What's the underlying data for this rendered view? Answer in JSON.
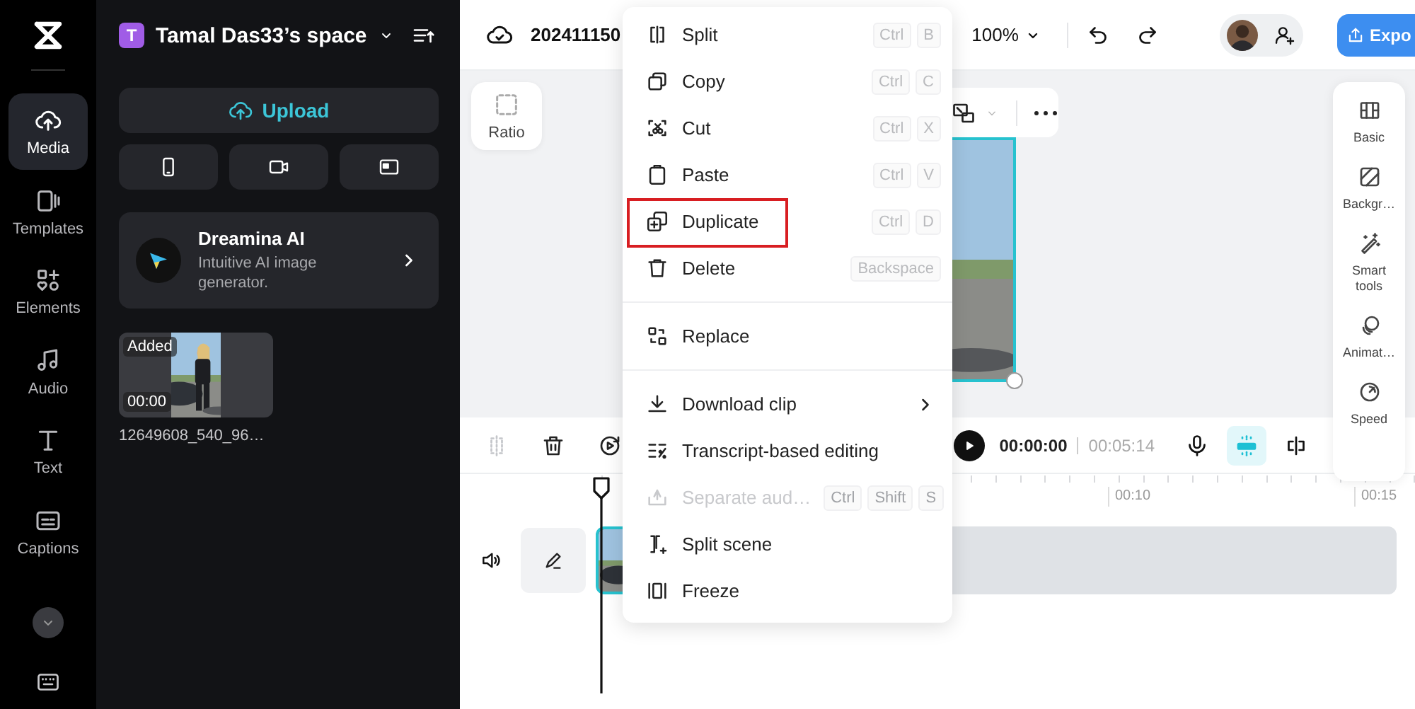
{
  "nav": {
    "items": [
      {
        "label": "Media",
        "selected": true
      },
      {
        "label": "Templates",
        "selected": false
      },
      {
        "label": "Elements",
        "selected": false
      },
      {
        "label": "Audio",
        "selected": false
      },
      {
        "label": "Text",
        "selected": false
      },
      {
        "label": "Captions",
        "selected": false
      }
    ]
  },
  "panel": {
    "space": {
      "initial": "T",
      "name": "Tamal Das33’s space"
    },
    "upload": "Upload",
    "promo": {
      "title": "Dreamina AI",
      "subtitle": "Intuitive AI image generator."
    },
    "media": [
      {
        "badge": "Added",
        "duration": "00:00",
        "filename": "12649608_540_96…"
      }
    ]
  },
  "topbar": {
    "project_name": "202411150",
    "zoom": "100%",
    "export": "Expo"
  },
  "canvas": {
    "ratio": "Ratio",
    "properties": [
      {
        "label": "Basic"
      },
      {
        "label": "Backgr…"
      },
      {
        "label": "Smart tools"
      },
      {
        "label": "Animat…"
      },
      {
        "label": "Speed"
      }
    ]
  },
  "player": {
    "tools": [
      {
        "disabled": true
      },
      {
        "disabled": false
      },
      {
        "disabled": false
      }
    ],
    "current_time": "00:00:00",
    "duration": "00:05:14",
    "snap": {
      "on": true
    }
  },
  "timeline": {
    "ticks": [
      "00:10",
      "00:15"
    ]
  },
  "context_menu": {
    "items": [
      {
        "kind": "item",
        "label": "Split",
        "shortcut": [
          "Ctrl",
          "B"
        ],
        "disabled": false,
        "highlighted": false,
        "submenu": false
      },
      {
        "kind": "item",
        "label": "Copy",
        "shortcut": [
          "Ctrl",
          "C"
        ],
        "disabled": false,
        "highlighted": false,
        "submenu": false
      },
      {
        "kind": "item",
        "label": "Cut",
        "shortcut": [
          "Ctrl",
          "X"
        ],
        "disabled": false,
        "highlighted": false,
        "submenu": false
      },
      {
        "kind": "item",
        "label": "Paste",
        "shortcut": [
          "Ctrl",
          "V"
        ],
        "disabled": false,
        "highlighted": false,
        "submenu": false
      },
      {
        "kind": "item",
        "label": "Duplicate",
        "shortcut": [
          "Ctrl",
          "D"
        ],
        "disabled": false,
        "highlighted": true,
        "submenu": false
      },
      {
        "kind": "item",
        "label": "Delete",
        "shortcut": [
          "Backspace"
        ],
        "disabled": false,
        "highlighted": false,
        "submenu": false
      },
      {
        "kind": "divider"
      },
      {
        "kind": "item",
        "label": "Replace",
        "disabled": false,
        "highlighted": false,
        "submenu": false
      },
      {
        "kind": "divider"
      },
      {
        "kind": "item",
        "label": "Download clip",
        "disabled": false,
        "highlighted": false,
        "submenu": true
      },
      {
        "kind": "item",
        "label": "Transcript-based editing",
        "disabled": false,
        "highlighted": false,
        "submenu": false
      },
      {
        "kind": "item",
        "label": "Separate aud…",
        "shortcut": [
          "Ctrl",
          "Shift",
          "S"
        ],
        "disabled": true,
        "highlighted": false,
        "submenu": false
      },
      {
        "kind": "item",
        "label": "Split scene",
        "disabled": false,
        "highlighted": false,
        "submenu": false
      },
      {
        "kind": "item",
        "label": "Freeze",
        "disabled": false,
        "highlighted": false,
        "submenu": false
      }
    ]
  }
}
